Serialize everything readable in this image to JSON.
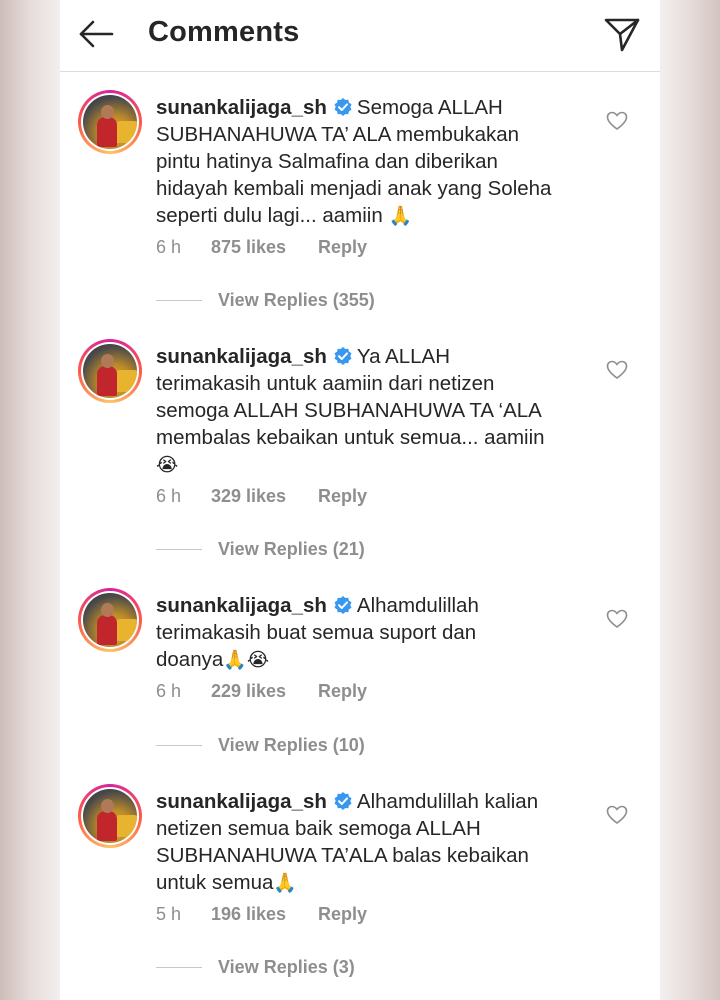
{
  "header": {
    "title": "Comments"
  },
  "comments": [
    {
      "username": "sunankalijaga_sh",
      "lines": [
        "Semoga ALLAH",
        "SUBHANAHUWA TA’ ALA membukakan",
        "pintu hatinya Salmafina dan diberikan",
        "hidayah kembali menjadi anak yang Soleha",
        "seperti dulu lagi... aamiin"
      ],
      "emoji": "🙏",
      "time": "6 h",
      "likes": "875 likes",
      "reply_label": "Reply",
      "view_replies": "View Replies (355)"
    },
    {
      "username": "sunankalijaga_sh",
      "lines": [
        "Ya ALLAH",
        "terimakasih untuk aamiin dari netizen",
        "semoga ALLAH SUBHANAHUWA TA ‘ALA",
        "membalas kebaikan untuk semua... aamiin"
      ],
      "emoji": "😭",
      "time": "6 h",
      "likes": "329 likes",
      "reply_label": "Reply",
      "view_replies": "View Replies (21)"
    },
    {
      "username": "sunankalijaga_sh",
      "lines": [
        "Alhamdulillah",
        "terimakasih buat semua suport dan",
        "doanya"
      ],
      "emoji": "🙏😭",
      "time": "6 h",
      "likes": "229 likes",
      "reply_label": "Reply",
      "view_replies": "View Replies (10)"
    },
    {
      "username": "sunankalijaga_sh",
      "lines": [
        "Alhamdulillah kalian",
        "netizen semua baik semoga ALLAH",
        "SUBHANAHUWA TA’ALA balas kebaikan",
        "untuk semua"
      ],
      "emoji": "🙏",
      "time": "5 h",
      "likes": "196 likes",
      "reply_label": "Reply",
      "view_replies": "View Replies (3)"
    }
  ]
}
